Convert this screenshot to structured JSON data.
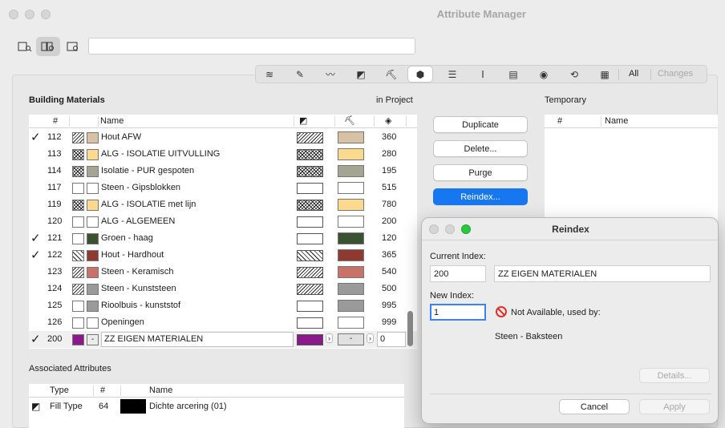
{
  "window": {
    "title": "Attribute Manager"
  },
  "toolbar": {
    "all_label": "All",
    "changes_label": "Changes"
  },
  "building_materials": {
    "heading": "Building Materials",
    "in_project_label": "in Project",
    "columns": {
      "number": "#",
      "name": "Name"
    },
    "rows": [
      {
        "checked": true,
        "num": "112",
        "name": "Hout AFW",
        "color": "#d8c2a6",
        "cut": "hatch1",
        "pat": "hatch1",
        "qty": "360"
      },
      {
        "checked": false,
        "num": "113",
        "name": "ALG - ISOLATIE UITVULLING",
        "color": "#fbd98e",
        "cut": "hatch2",
        "pat": "hatch2",
        "qty": "280"
      },
      {
        "checked": false,
        "num": "114",
        "name": "Isolatie - PUR gespoten",
        "color": "#a4a693",
        "cut": "hatch2",
        "pat": "hatch2",
        "qty": "195"
      },
      {
        "checked": false,
        "num": "117",
        "name": "Steen - Gipsblokken",
        "color": "#ffffff",
        "cut": "none",
        "pat": "none",
        "qty": "515"
      },
      {
        "checked": false,
        "num": "119",
        "name": "ALG - ISOLATIE met lijn",
        "color": "#fbd98e",
        "cut": "hatch2",
        "pat": "hatch2",
        "qty": "780"
      },
      {
        "checked": false,
        "num": "120",
        "name": "ALG - ALGEMEEN",
        "color": "#ffffff",
        "cut": "none",
        "pat": "none",
        "qty": "200"
      },
      {
        "checked": true,
        "num": "121",
        "name": "Groen - haag",
        "color": "#3a5230",
        "cut": "none",
        "pat": "none",
        "qty": "120"
      },
      {
        "checked": true,
        "num": "122",
        "name": "Hout - Hardhout",
        "color": "#8e3a30",
        "cut": "hatch3",
        "pat": "hatch3",
        "qty": "365"
      },
      {
        "checked": false,
        "num": "123",
        "name": "Steen - Keramisch",
        "color": "#c9726a",
        "cut": "hatch1",
        "pat": "hatch1",
        "qty": "540"
      },
      {
        "checked": false,
        "num": "124",
        "name": "Steen - Kunststeen",
        "color": "#9a9a9a",
        "cut": "hatch1",
        "pat": "hatch1",
        "qty": "500"
      },
      {
        "checked": false,
        "num": "125",
        "name": "Rioolbuis - kunststof",
        "color": "#9a9a9a",
        "cut": "none",
        "pat": "none",
        "qty": "995"
      },
      {
        "checked": false,
        "num": "126",
        "name": "Openingen",
        "color": "#ffffff",
        "cut": "none",
        "pat": "none",
        "qty": "999"
      }
    ],
    "selected_row": {
      "checked": true,
      "num": "200",
      "name": "ZZ EIGEN MATERIALEN",
      "color": "#8a1a8a",
      "dash": "-",
      "qty": "0"
    }
  },
  "actions": {
    "duplicate": "Duplicate",
    "delete": "Delete...",
    "purge": "Purge",
    "reindex": "Reindex..."
  },
  "temporary": {
    "heading": "Temporary",
    "columns": {
      "number": "#",
      "name": "Name"
    }
  },
  "associated": {
    "heading": "Associated Attributes",
    "columns": {
      "type": "Type",
      "number": "#",
      "name": "Name"
    },
    "row": {
      "type": "Fill Type",
      "num": "64",
      "name": "Dichte arcering (01)"
    }
  },
  "reindex_dialog": {
    "title": "Reindex",
    "current_index_label": "Current Index:",
    "current_index_value": "200",
    "current_name": "ZZ EIGEN MATERIALEN",
    "new_index_label": "New Index:",
    "new_index_value": "1",
    "not_available": "Not Available, used by:",
    "used_by": "Steen - Baksteen",
    "details_label": "Details...",
    "cancel_label": "Cancel",
    "apply_label": "Apply"
  }
}
